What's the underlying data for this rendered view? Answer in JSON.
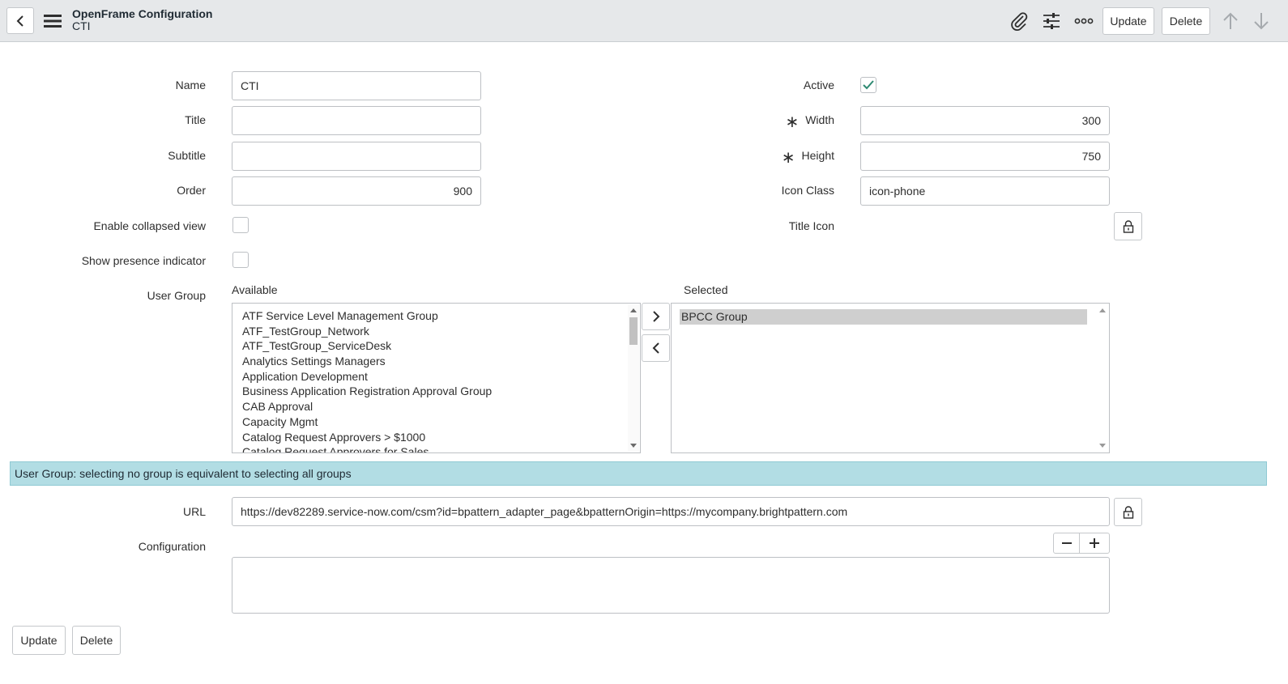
{
  "header": {
    "title": "OpenFrame Configuration",
    "subtitle": "CTI",
    "update_label": "Update",
    "delete_label": "Delete"
  },
  "form": {
    "name": {
      "label": "Name",
      "value": "CTI"
    },
    "title": {
      "label": "Title",
      "value": ""
    },
    "subtitle": {
      "label": "Subtitle",
      "value": ""
    },
    "order": {
      "label": "Order",
      "value": "900"
    },
    "collapsed": {
      "label": "Enable collapsed view",
      "checked": false
    },
    "presence": {
      "label": "Show presence indicator",
      "checked": false
    },
    "active": {
      "label": "Active",
      "checked": true
    },
    "width": {
      "label": "Width",
      "value": "300"
    },
    "height": {
      "label": "Height",
      "value": "750"
    },
    "icon_class": {
      "label": "Icon Class",
      "value": "icon-phone"
    },
    "title_icon": {
      "label": "Title Icon"
    },
    "user_group": {
      "label": "User Group",
      "available_label": "Available",
      "selected_label": "Selected",
      "available": [
        "ATF Service Level Management Group",
        "ATF_TestGroup_Network",
        "ATF_TestGroup_ServiceDesk",
        "Analytics Settings Managers",
        "Application Development",
        "Business Application Registration Approval Group",
        "CAB Approval",
        "Capacity Mgmt",
        "Catalog Request Approvers > $1000",
        "Catalog Request Approvers for Sales"
      ],
      "selected": [
        "BPCC Group"
      ]
    },
    "info": "User Group: selecting no group is equivalent to selecting all groups",
    "url": {
      "label": "URL",
      "value": "https://dev82289.service-now.com/csm?id=bpattern_adapter_page&bpatternOrigin=https://mycompany.brightpattern.com"
    },
    "configuration": {
      "label": "Configuration",
      "value": ""
    }
  },
  "footer": {
    "update_label": "Update",
    "delete_label": "Delete"
  },
  "colors": {
    "header_bg": "#e6e8ea",
    "info_bg": "#b2dde4",
    "check": "#2e8a72",
    "selected_bg": "#cfcfcf"
  }
}
